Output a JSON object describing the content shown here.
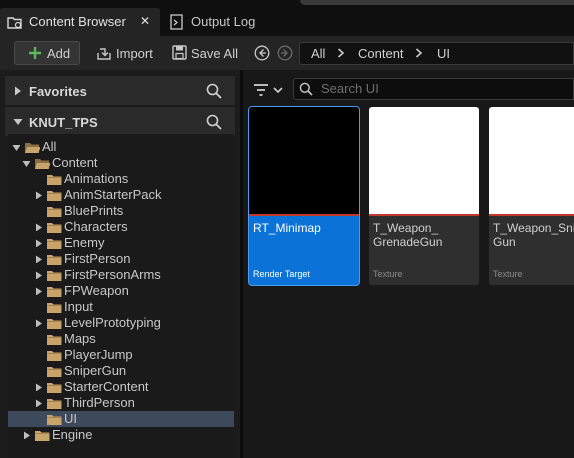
{
  "tabs": [
    {
      "label": "Content Browser",
      "close": "✕"
    },
    {
      "label": "Output Log"
    }
  ],
  "toolbar": {
    "add_label": "Add",
    "import_label": "Import",
    "save_all_label": "Save All"
  },
  "breadcrumb": [
    "All",
    "Content",
    "UI"
  ],
  "sidebar": {
    "favorites_label": "Favorites",
    "project_label": "KNUT_TPS",
    "tree": [
      {
        "label": "All",
        "depth": 0,
        "expanded": true,
        "open": true
      },
      {
        "label": "Content",
        "depth": 1,
        "expanded": true,
        "open": true
      },
      {
        "label": "Animations",
        "depth": 2,
        "children": false
      },
      {
        "label": "AnimStarterPack",
        "depth": 2,
        "children": true
      },
      {
        "label": "BluePrints",
        "depth": 2,
        "children": false
      },
      {
        "label": "Characters",
        "depth": 2,
        "children": true
      },
      {
        "label": "Enemy",
        "depth": 2,
        "children": true
      },
      {
        "label": "FirstPerson",
        "depth": 2,
        "children": true
      },
      {
        "label": "FirstPersonArms",
        "depth": 2,
        "children": true
      },
      {
        "label": "FPWeapon",
        "depth": 2,
        "children": true
      },
      {
        "label": "Input",
        "depth": 2,
        "children": false
      },
      {
        "label": "LevelPrototyping",
        "depth": 2,
        "children": true
      },
      {
        "label": "Maps",
        "depth": 2,
        "children": false
      },
      {
        "label": "PlayerJump",
        "depth": 2,
        "children": false
      },
      {
        "label": "SniperGun",
        "depth": 2,
        "children": false
      },
      {
        "label": "StarterContent",
        "depth": 2,
        "children": true
      },
      {
        "label": "ThirdPerson",
        "depth": 2,
        "children": true
      },
      {
        "label": "UI",
        "depth": 2,
        "children": false,
        "selected": true
      },
      {
        "label": "Engine",
        "depth": 1,
        "children": true
      }
    ]
  },
  "search": {
    "placeholder": "Search UI"
  },
  "assets": [
    {
      "name": "RT_Minimap",
      "type": "Render Target",
      "thumb_color": "#000000",
      "bar_color": "#c0392b",
      "selected": true
    },
    {
      "name": "T_Weapon_\nGrenadeGun",
      "type": "Texture",
      "thumb_color": "#ffffff",
      "bar_color": "#c0392b"
    },
    {
      "name": "T_Weapon_Snip\nGun",
      "type": "Texture",
      "thumb_color": "#ffffff",
      "bar_color": "#c0392b"
    }
  ],
  "colors": {
    "accent": "#0b73d8",
    "add_icon": "#5cb85c",
    "folder": "#c8a46a"
  }
}
